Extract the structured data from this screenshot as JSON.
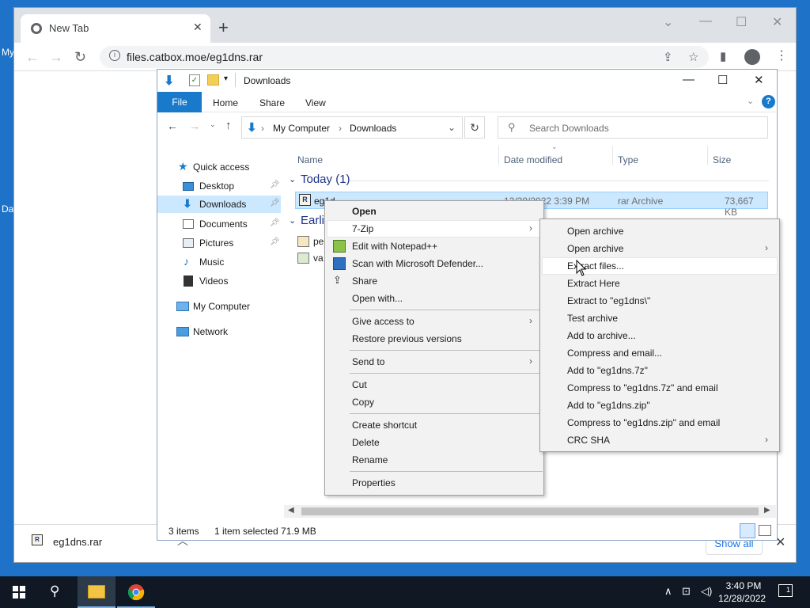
{
  "desktop": {
    "labels": [
      "My",
      "Da"
    ]
  },
  "chrome": {
    "tab_title": "New Tab",
    "url": "files.catbox.moe/eg1dns.rar",
    "download_bar": {
      "file_name": "eg1dns.rar",
      "show_all": "Show all"
    }
  },
  "explorer": {
    "title": "Downloads",
    "ribbon_tabs": [
      "File",
      "Home",
      "Share",
      "View"
    ],
    "breadcrumb": [
      "My Computer",
      "Downloads"
    ],
    "search_placeholder": "Search Downloads",
    "nav": {
      "quick_access": "Quick access",
      "items": [
        "Desktop",
        "Downloads",
        "Documents",
        "Pictures",
        "Music",
        "Videos"
      ],
      "my_computer": "My Computer",
      "network": "Network"
    },
    "columns": [
      "Name",
      "Date modified",
      "Type",
      "Size"
    ],
    "groups": {
      "today": "Today (1)",
      "earlier": "Earli"
    },
    "selected_file": {
      "name": "eg1d",
      "date": "12/28/2022 3:39 PM",
      "type": "rar Archive",
      "size": "73,667 KB"
    },
    "other_files": [
      "pe",
      "va"
    ],
    "status": {
      "items": "3 items",
      "selected": "1 item selected  71.9 MB"
    }
  },
  "context_menu": {
    "items": {
      "open": "Open",
      "sevenzip": "7-Zip",
      "notepad": "Edit with Notepad++",
      "defender": "Scan with Microsoft Defender...",
      "share": "Share",
      "open_with": "Open with...",
      "give_access": "Give access to",
      "restore": "Restore previous versions",
      "send_to": "Send to",
      "cut": "Cut",
      "copy": "Copy",
      "create_shortcut": "Create shortcut",
      "delete": "Delete",
      "rename": "Rename",
      "properties": "Properties"
    }
  },
  "sevenzip_menu": {
    "items": [
      "Open archive",
      "Open archive",
      "Extract files...",
      "Extract Here",
      "Extract to \"eg1dns\\\"",
      "Test archive",
      "Add to archive...",
      "Compress and email...",
      "Add to \"eg1dns.7z\"",
      "Compress to \"eg1dns.7z\" and email",
      "Add to \"eg1dns.zip\"",
      "Compress to \"eg1dns.zip\" and email",
      "CRC SHA"
    ]
  },
  "taskbar": {
    "time": "3:40 PM",
    "date": "12/28/2022",
    "notification_count": "1"
  },
  "colors": {
    "accent": "#1979ca",
    "selection": "#cce8ff",
    "taskbar": "#101923",
    "desktop": "#1e73c9"
  }
}
